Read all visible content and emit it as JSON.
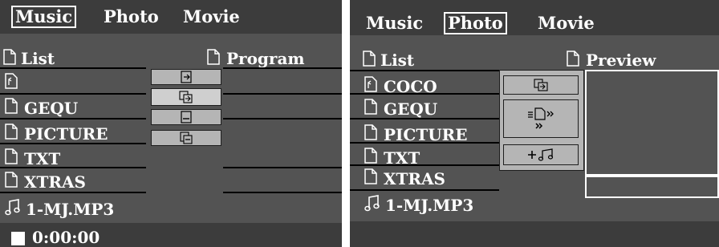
{
  "music_screen": {
    "tabs": [
      {
        "label": "Music",
        "selected": true
      },
      {
        "label": "Photo",
        "selected": false
      },
      {
        "label": "Movie",
        "selected": false
      }
    ],
    "list_header": "List",
    "program_header": "Program",
    "files": [
      {
        "name": "",
        "icon": "folder-up-icon"
      },
      {
        "name": "GEQU",
        "icon": "folder-icon"
      },
      {
        "name": "PICTURE",
        "icon": "folder-icon"
      },
      {
        "name": "TXT",
        "icon": "folder-icon"
      },
      {
        "name": "XTRAS",
        "icon": "folder-icon"
      },
      {
        "name": "1-MJ.MP3",
        "icon": "music-note-icon"
      }
    ],
    "buttons": [
      "add-to-program-icon",
      "insert-icon",
      "remove-icon",
      "clear-program-icon"
    ],
    "status": {
      "time": "0:00:00",
      "icon": "stop-icon"
    }
  },
  "photo_screen": {
    "tabs": [
      {
        "label": "Music",
        "selected": false
      },
      {
        "label": "Photo",
        "selected": true
      },
      {
        "label": "Movie",
        "selected": false
      }
    ],
    "list_header": "List",
    "preview_header": "Preview",
    "files": [
      {
        "name": "COCO",
        "icon": "folder-up-icon"
      },
      {
        "name": "GEQU",
        "icon": "folder-icon"
      },
      {
        "name": "PICTURE",
        "icon": "folder-icon"
      },
      {
        "name": "TXT",
        "icon": "folder-icon"
      },
      {
        "name": "XTRAS",
        "icon": "folder-icon"
      },
      {
        "name": "1-MJ.MP3",
        "icon": "music-note-icon"
      }
    ],
    "buttons": [
      "slideshow-icon",
      "slide-transition-icon",
      "add-music-icon"
    ]
  }
}
